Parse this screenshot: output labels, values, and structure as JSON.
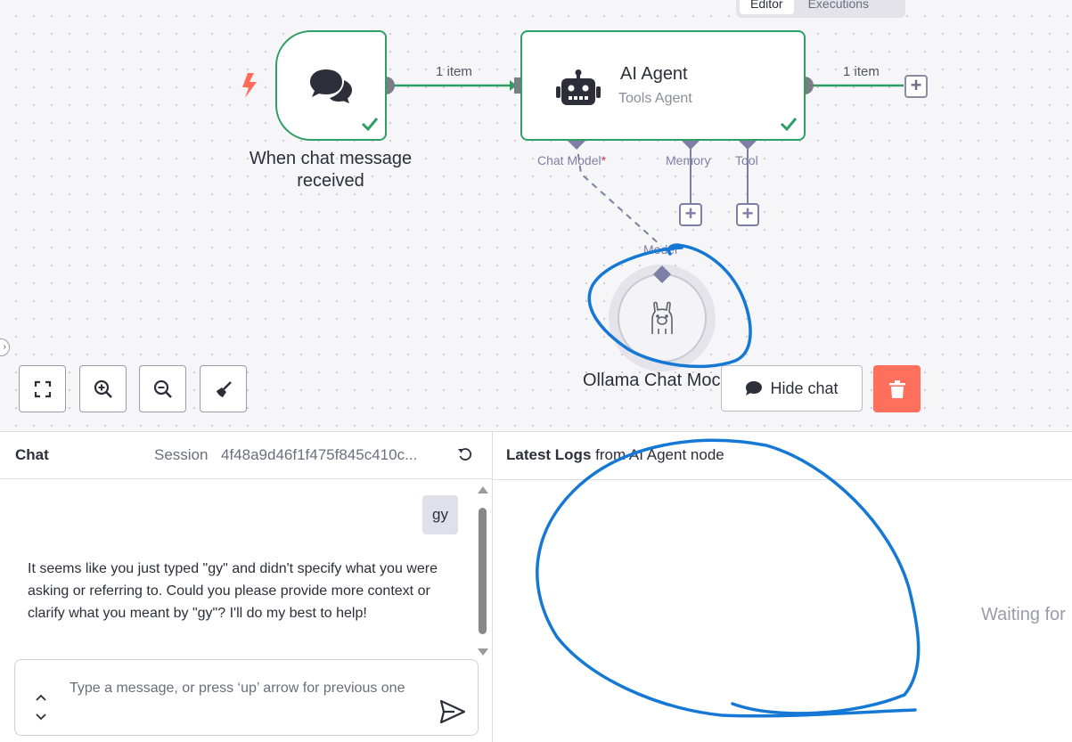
{
  "header": {
    "tabs": [
      {
        "label": "Editor",
        "active": true
      },
      {
        "label": "Executions",
        "active": false
      }
    ]
  },
  "canvas": {
    "trigger_node": {
      "name": "When chat message received",
      "name_line1": "When chat message",
      "name_line2": "received",
      "icon": "chat-bubbles-icon",
      "status": "success"
    },
    "agent_node": {
      "name": "AI Agent",
      "subtitle": "Tools Agent",
      "icon": "robot-icon",
      "status": "success",
      "ports": {
        "chat_model": "Chat Model",
        "chat_model_required": "*",
        "memory": "Memory",
        "tool": "Tool"
      }
    },
    "connection_labels": {
      "trigger_to_agent": "1 item",
      "agent_output": "1 item"
    },
    "ollama_node": {
      "name": "Ollama Chat Model",
      "visible_name": "Ollama Chat Moc",
      "port_label": "Model",
      "icon": "llama-icon"
    },
    "controls": {
      "fit_view": "fit-view-icon",
      "zoom_in": "zoom-in-icon",
      "zoom_out": "zoom-out-icon",
      "tidy": "broom-icon",
      "hide_chat_label": "Hide chat"
    }
  },
  "chat": {
    "title": "Chat",
    "session_label": "Session",
    "session_id": "4f48a9d46f1f475f845c410c...",
    "messages": [
      {
        "role": "user",
        "text": "gy"
      },
      {
        "role": "bot",
        "text": "It seems like you just typed \"gy\" and didn't specify what you were asking or referring to. Could you please provide more context or clarify what you meant by \"gy\"? I'll do my best to help!"
      }
    ],
    "input_placeholder": "Type a message, or press ‘up’ arrow for previous one"
  },
  "logs": {
    "title_bold": "Latest Logs",
    "title_rest": " from AI Agent node",
    "waiting_text": "Waiting for"
  },
  "colors": {
    "success_green": "#2f9e64",
    "sub_port": "#7d7fa5",
    "required": "#e0315f",
    "delete": "#ff6f5c",
    "annotation_blue": "#1478d4"
  }
}
